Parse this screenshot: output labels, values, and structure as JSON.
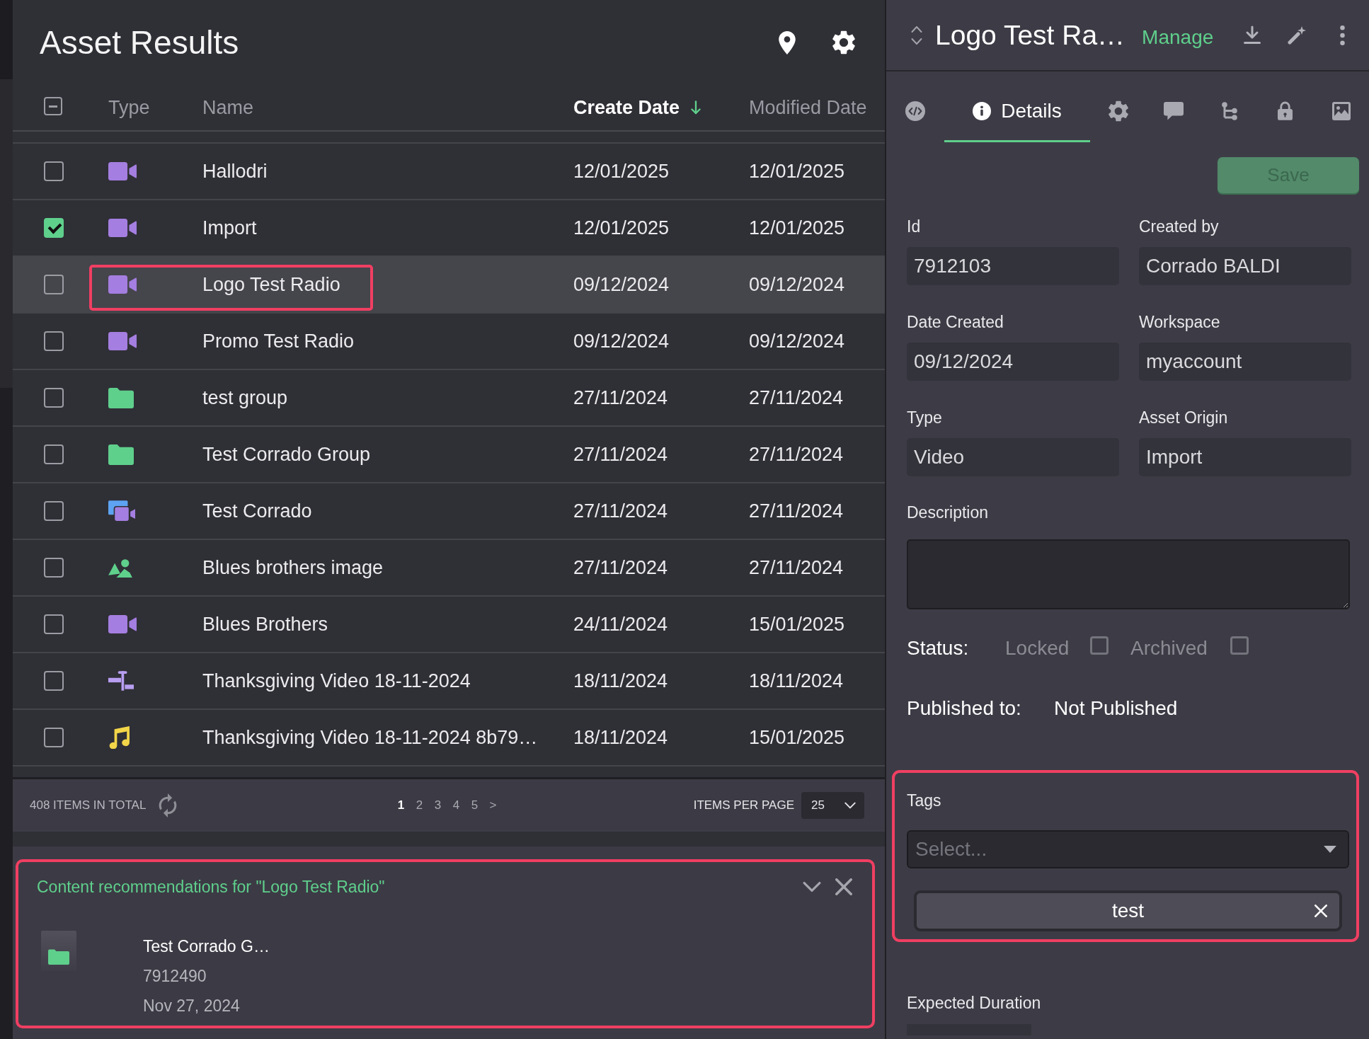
{
  "results": {
    "title": "Asset Results",
    "select_all": {
      "indeterminate": true
    },
    "columns": [
      {
        "label": "Type",
        "sorted": false
      },
      {
        "label": "Name",
        "sorted": false
      },
      {
        "label": "Create Date",
        "sorted": true
      },
      {
        "label": "Modified Date",
        "sorted": false
      }
    ],
    "rows": [
      {
        "kind": "video",
        "name": "Hallodri",
        "create_date": "12/01/2025",
        "modified_date": "12/01/2025",
        "checked": false,
        "selected": false,
        "highlighted": false
      },
      {
        "kind": "video",
        "name": "Import",
        "create_date": "12/01/2025",
        "modified_date": "12/01/2025",
        "checked": true,
        "selected": false,
        "highlighted": false
      },
      {
        "kind": "video",
        "name": "Logo Test Radio",
        "create_date": "09/12/2024",
        "modified_date": "09/12/2024",
        "checked": false,
        "selected": true,
        "highlighted": true
      },
      {
        "kind": "video",
        "name": "Promo Test Radio",
        "create_date": "09/12/2024",
        "modified_date": "09/12/2024",
        "checked": false,
        "selected": false,
        "highlighted": false
      },
      {
        "kind": "folder",
        "name": "test group",
        "create_date": "27/11/2024",
        "modified_date": "27/11/2024",
        "checked": false,
        "selected": false,
        "highlighted": false
      },
      {
        "kind": "folder",
        "name": "Test Corrado Group",
        "create_date": "27/11/2024",
        "modified_date": "27/11/2024",
        "checked": false,
        "selected": false,
        "highlighted": false
      },
      {
        "kind": "composite",
        "name": "Test Corrado",
        "create_date": "27/11/2024",
        "modified_date": "27/11/2024",
        "checked": false,
        "selected": false,
        "highlighted": false
      },
      {
        "kind": "image",
        "name": "Blues brothers image",
        "create_date": "27/11/2024",
        "modified_date": "27/11/2024",
        "checked": false,
        "selected": false,
        "highlighted": false
      },
      {
        "kind": "video",
        "name": "Blues Brothers",
        "create_date": "24/11/2024",
        "modified_date": "15/01/2025",
        "checked": false,
        "selected": false,
        "highlighted": false
      },
      {
        "kind": "timeline",
        "name": "Thanksgiving Video 18-11-2024",
        "create_date": "18/11/2024",
        "modified_date": "18/11/2024",
        "checked": false,
        "selected": false,
        "highlighted": false
      },
      {
        "kind": "audio",
        "name": "Thanksgiving Video 18-11-2024 8b79…",
        "create_date": "18/11/2024",
        "modified_date": "15/01/2025",
        "checked": false,
        "selected": false,
        "highlighted": false
      }
    ]
  },
  "pagination": {
    "total": "408 ITEMS IN TOTAL",
    "pages": [
      {
        "label": "1",
        "selected": true
      },
      {
        "label": "2",
        "selected": false
      },
      {
        "label": "3",
        "selected": false
      },
      {
        "label": "4",
        "selected": false
      },
      {
        "label": "5",
        "selected": false
      },
      {
        "label": ">",
        "selected": false
      }
    ],
    "per_page_label": "ITEMS PER PAGE",
    "per_page": "25"
  },
  "recommendations": {
    "title": "Content recommendations for \"Logo Test Radio\"",
    "highlighted": true,
    "items": [
      {
        "kind": "folder",
        "name": "Test Corrado G…",
        "id": "7912490",
        "date": "Nov 27, 2024"
      }
    ]
  },
  "details": {
    "title": "Logo Test Ra…",
    "manage": "Manage",
    "tabs": [
      {
        "kind": "code",
        "selected": false
      },
      {
        "kind": "details",
        "label": "Details",
        "selected": true
      },
      {
        "kind": "settings",
        "selected": false
      },
      {
        "kind": "comments",
        "selected": false
      },
      {
        "kind": "hierarchy",
        "selected": false
      },
      {
        "kind": "lock",
        "selected": false
      },
      {
        "kind": "media",
        "selected": false
      }
    ],
    "save": {
      "label": "Save",
      "disabled": true
    },
    "fields": [
      {
        "label": "Id",
        "value": "7912103"
      },
      {
        "label": "Created by",
        "value": "Corrado BALDI"
      },
      {
        "label": "Date Created",
        "value": "09/12/2024"
      },
      {
        "label": "Workspace",
        "value": "myaccount"
      },
      {
        "label": "Type",
        "value": "Video"
      },
      {
        "label": "Asset Origin",
        "value": "Import"
      }
    ],
    "description": {
      "label": "Description"
    },
    "status": {
      "label": "Status:",
      "options": [
        {
          "label": "Locked",
          "checked": false,
          "disabled": true
        },
        {
          "label": "Archived",
          "checked": false,
          "disabled": true
        }
      ]
    },
    "published": {
      "label": "Published to:",
      "value": "Not Published"
    },
    "tags": {
      "label": "Tags",
      "placeholder": "Select...",
      "highlighted": true,
      "items": [
        {
          "label": "test"
        }
      ]
    },
    "expected_duration": {
      "label": "Expected Duration"
    }
  }
}
